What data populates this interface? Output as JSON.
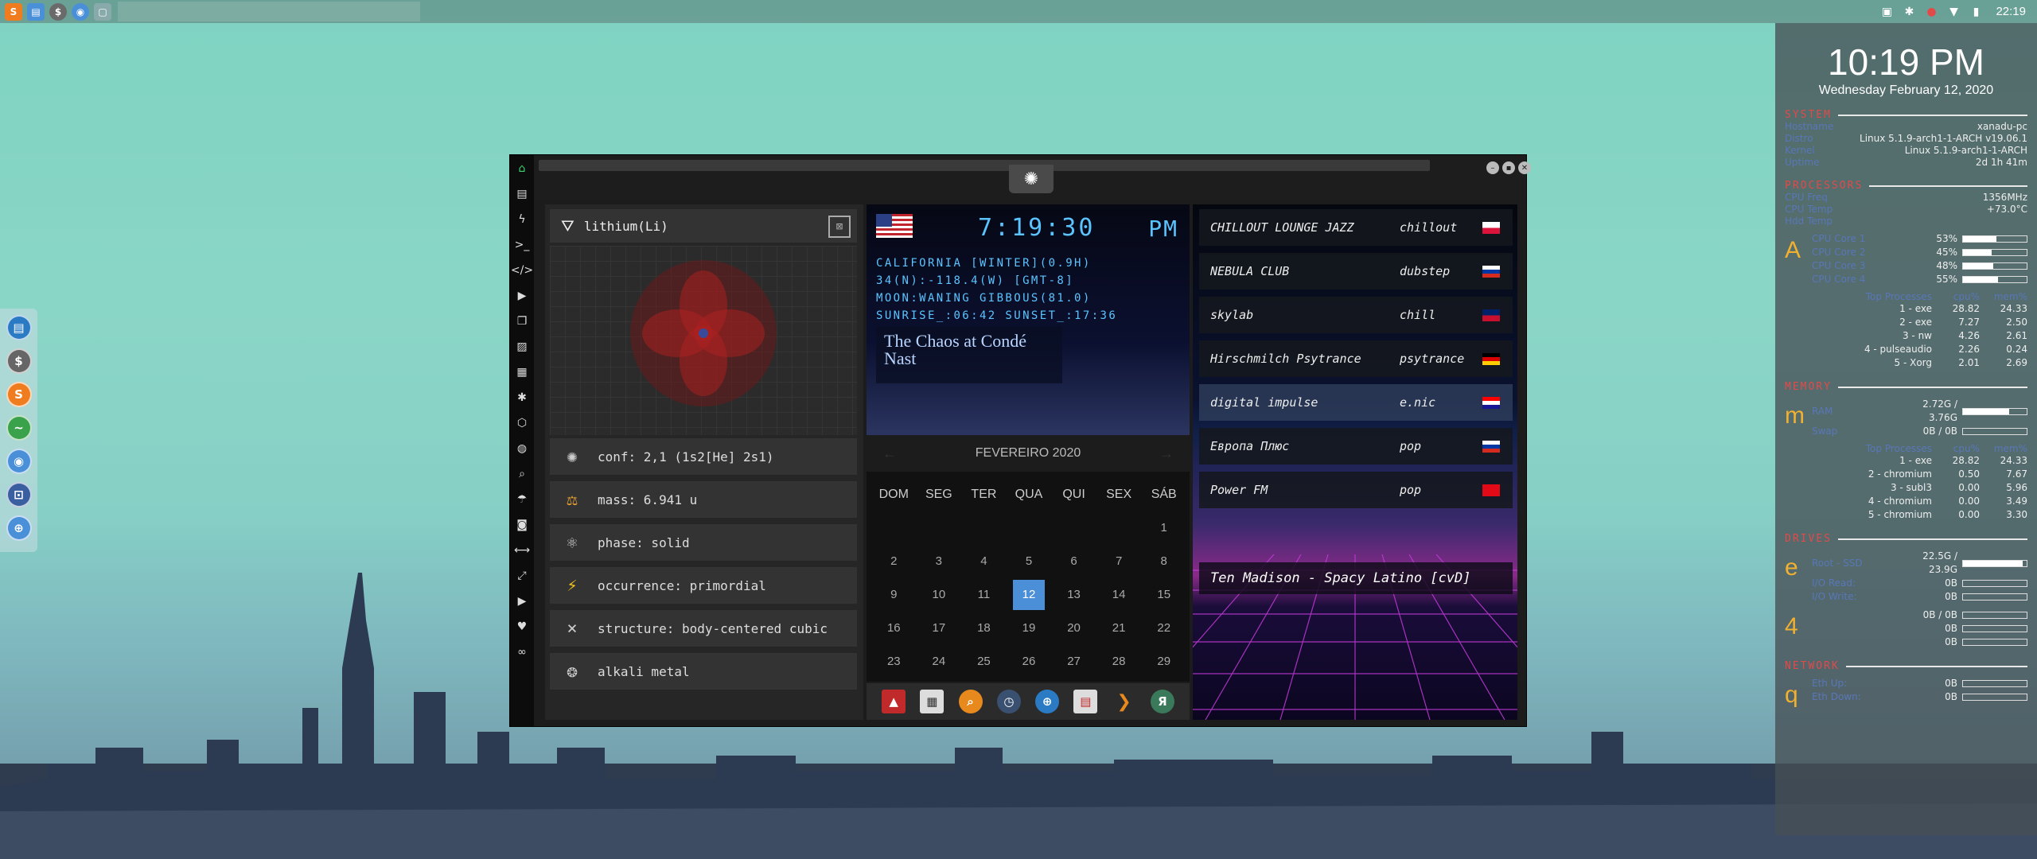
{
  "top_panel": {
    "launchers": [
      {
        "icon": "sublime-icon",
        "color": "#f07c20"
      },
      {
        "icon": "folder-icon",
        "color": "#4a90d9"
      },
      {
        "icon": "dollar-icon",
        "color": "#6a6a6a"
      },
      {
        "icon": "chromium-icon",
        "color": "#4a90d9"
      },
      {
        "icon": "window-icon",
        "color": "#8aa"
      }
    ],
    "clock": "22:19"
  },
  "conky": {
    "time": "10:19 PM",
    "date": "Wednesday February 12, 2020",
    "sections": {
      "system": "SYSTEM",
      "processors": "PROCESSORS",
      "memory": "MEMORY",
      "drives": "DRIVES",
      "network": "NETWORK"
    },
    "system_rows": [
      {
        "k": "Hostname",
        "v": "xanadu-pc"
      },
      {
        "k": "Distro",
        "v": "Linux 5.1.9-arch1-1-ARCH v19.06.1"
      },
      {
        "k": "Kernel",
        "v": "Linux 5.1.9-arch1-1-ARCH"
      },
      {
        "k": "Uptime",
        "v": "2d 1h 41m"
      }
    ],
    "cpu_rows": [
      {
        "k": "CPU Freq",
        "v": "1356MHz"
      },
      {
        "k": "CPU Temp",
        "v": "+73.0°C"
      },
      {
        "k": "Hdd Temp",
        "v": ""
      }
    ],
    "cpu_letter": "A",
    "cores": [
      {
        "k": "CPU Core 1",
        "v": "53%",
        "pct": 53
      },
      {
        "k": "CPU Core 2",
        "v": "45%",
        "pct": 45
      },
      {
        "k": "CPU Core 3",
        "v": "48%",
        "pct": 48
      },
      {
        "k": "CPU Core 4",
        "v": "55%",
        "pct": 55
      }
    ],
    "top_proc_header": {
      "name": "Top Processes",
      "c1": "cpu%",
      "c2": "mem%"
    },
    "top_cpu": [
      {
        "n": "1 - exe",
        "a": "28.82",
        "b": "24.33"
      },
      {
        "n": "2 - exe",
        "a": "7.27",
        "b": "2.50"
      },
      {
        "n": "3 - nw",
        "a": "4.26",
        "b": "2.61"
      },
      {
        "n": "4 - pulseaudio",
        "a": "2.26",
        "b": "0.24"
      },
      {
        "n": "5 - Xorg",
        "a": "2.01",
        "b": "2.69"
      }
    ],
    "mem_letter": "m",
    "mem_rows": [
      {
        "k": "RAM",
        "v": "2.72G / 3.76G",
        "pct": 72
      },
      {
        "k": "Swap",
        "v": "0B / 0B",
        "pct": 0
      }
    ],
    "top_mem": [
      {
        "n": "1 - exe",
        "a": "28.82",
        "b": "24.33"
      },
      {
        "n": "2 - chromium",
        "a": "0.50",
        "b": "7.67"
      },
      {
        "n": "3 - subl3",
        "a": "0.00",
        "b": "5.96"
      },
      {
        "n": "4 - chromium",
        "a": "0.00",
        "b": "3.49"
      },
      {
        "n": "5 - chromium",
        "a": "0.00",
        "b": "3.30"
      }
    ],
    "drive_letter_1": "e",
    "drive_rows_1": [
      {
        "k": "Root - SSD",
        "v": "22.5G / 23.9G",
        "pct": 94
      },
      {
        "k": "I/O Read:",
        "v": "0B",
        "pct": 0
      },
      {
        "k": "I/O Write:",
        "v": "0B",
        "pct": 0
      }
    ],
    "drive_letter_2": "4",
    "drive_rows_2": [
      {
        "k": "",
        "v": "0B / 0B",
        "pct": 0
      },
      {
        "k": "",
        "v": "0B",
        "pct": 0
      },
      {
        "k": "",
        "v": "0B",
        "pct": 0
      }
    ],
    "net_letter": "q",
    "net_rows": [
      {
        "k": "Eth Up:",
        "v": "0B",
        "pct": 0
      },
      {
        "k": "Eth Down:",
        "v": "0B",
        "pct": 0
      }
    ]
  },
  "element": {
    "title": "lithium(Li)",
    "rows": [
      "conf: 2,1 (1s2[He] 2s1)",
      "mass: 6.941 u",
      "phase: solid",
      "occurrence: primordial",
      "structure: body-centered cubic",
      "alkali metal"
    ]
  },
  "clock_panel": {
    "time": "7:19:30",
    "ampm": "PM",
    "lines": [
      "CALIFORNIA [WINTER](0.9H)",
      "34(N):-118.4(W) [GMT-8]",
      "MOON:WANING GIBBOUS(81.0)",
      "SUNRISE_:06:42 SUNSET_:17:36"
    ],
    "quote": "The Chaos at Condé Nast"
  },
  "calendar": {
    "month": "FEVEREIRO 2020",
    "dow": [
      "DOM",
      "SEG",
      "TER",
      "QUA",
      "QUI",
      "SEX",
      "SÁB"
    ],
    "days": [
      "",
      "",
      "",
      "",
      "",
      "",
      "1",
      "2",
      "3",
      "4",
      "5",
      "6",
      "7",
      "8",
      "9",
      "10",
      "11",
      "12",
      "13",
      "14",
      "15",
      "16",
      "17",
      "18",
      "19",
      "20",
      "21",
      "22",
      "23",
      "24",
      "25",
      "26",
      "27",
      "28",
      "29"
    ],
    "selected": "12"
  },
  "radio": {
    "stations": [
      {
        "name": "CHILLOUT LOUNGE JAZZ",
        "genre": "chillout",
        "flag": "pl"
      },
      {
        "name": "NEBULA CLUB",
        "genre": "dubstep",
        "flag": "ru"
      },
      {
        "name": "skylab",
        "genre": "chill",
        "flag": "gb"
      },
      {
        "name": "Hirschmilch Psytrance",
        "genre": "psytrance",
        "flag": "de"
      },
      {
        "name": "digital impulse",
        "genre": "e.nic",
        "flag": "hr"
      },
      {
        "name": "Европа Плюс",
        "genre": "pop",
        "flag": "ru"
      },
      {
        "name": "Power FM",
        "genre": "pop",
        "flag": "tr"
      }
    ],
    "now_playing": "Ten Madison - Spacy Latino [cvD]"
  },
  "colors": {
    "accent_blue": "#5bc4ff",
    "conky_red": "#e24a4a",
    "conky_key": "#5877b8",
    "conky_letter": "#f0b030",
    "calendar_selected": "#4a8fd8"
  }
}
